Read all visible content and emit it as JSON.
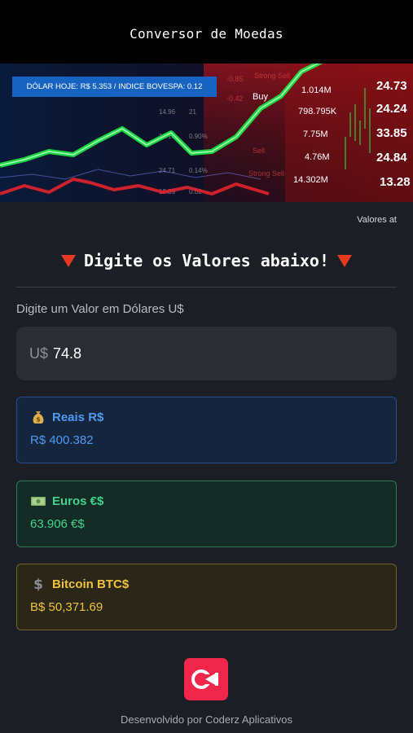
{
  "header": {
    "title": "Conversor de Moedas"
  },
  "hero": {
    "ticker": "DÓLAR HOJE: R$ 5.353 / INDICE BOVESPA: 0.12",
    "image": "stock-market-chart-image"
  },
  "updated_label": "Valores at",
  "prompt": {
    "text": "Digite os Valores abaixo!",
    "icon": "red-triangle-down-icon"
  },
  "input": {
    "label": "Digite um Valor em Dólares U$",
    "prefix": "U$",
    "value": "74.8"
  },
  "cards": [
    {
      "title": "Reais R$",
      "value": "R$ 400.382",
      "icon": "money-bag-icon",
      "color": "#4e9bf5"
    },
    {
      "title": "Euros €$",
      "value": "63.906 €$",
      "icon": "banknote-icon",
      "color": "#43d48e"
    },
    {
      "title": "Bitcoin BTC$",
      "value": "B$ 50,371.69",
      "icon": "dollar-sign-icon",
      "color": "#f2c23d"
    }
  ],
  "footer": {
    "text": "Desenvolvido por Coderz Aplicativos",
    "logo": "coderz-logo-icon"
  }
}
